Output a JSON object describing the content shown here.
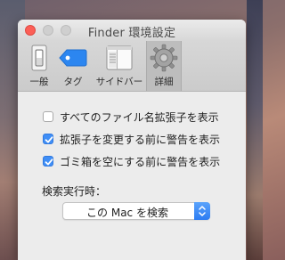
{
  "window": {
    "title": "Finder 環境設定",
    "close_color": "#fc5f57"
  },
  "toolbar": {
    "items": [
      {
        "label": "一般",
        "icon": "light-switch-icon",
        "selected": false
      },
      {
        "label": "タグ",
        "icon": "tag-icon",
        "selected": false
      },
      {
        "label": "サイドバー",
        "icon": "sidebar-icon",
        "selected": false
      },
      {
        "label": "詳細",
        "icon": "gear-icon",
        "selected": true
      }
    ]
  },
  "advanced": {
    "options": [
      {
        "label": "すべてのファイル名拡張子を表示",
        "checked": false
      },
      {
        "label": "拡張子を変更する前に警告を表示",
        "checked": true
      },
      {
        "label": "ゴミ箱を空にする前に警告を表示",
        "checked": true
      }
    ],
    "search_label": "検索実行時：",
    "search_scope": {
      "selected": "この Mac を検索"
    }
  },
  "colors": {
    "accent": "#3f8ef6"
  }
}
